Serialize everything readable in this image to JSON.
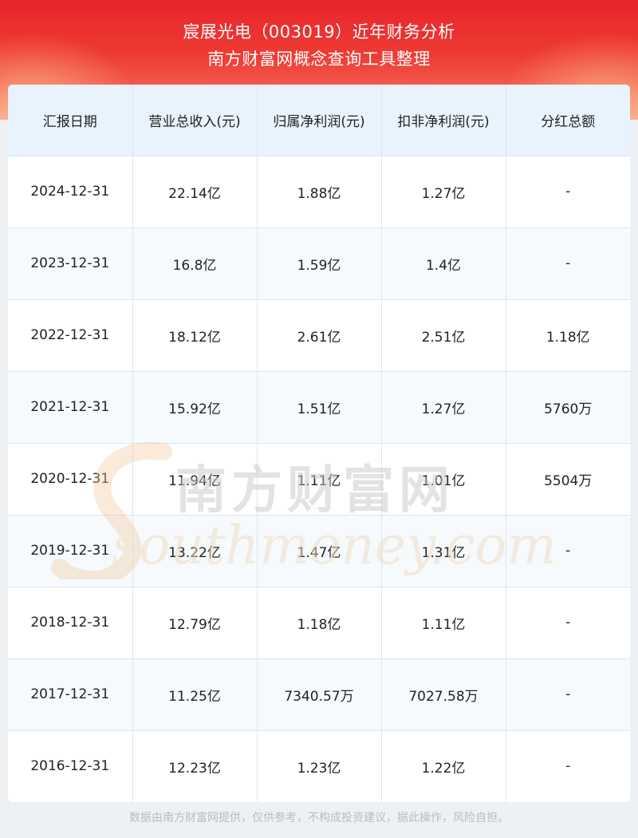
{
  "header": {
    "title_line1": "宸展光电（003019）近年财务分析",
    "title_line2": "南方财富网概念查询工具整理"
  },
  "table": {
    "columns": [
      "汇报日期",
      "营业总收入(元)",
      "归属净利润(元)",
      "扣非净利润(元)",
      "分红总额"
    ],
    "rows": [
      [
        "2024-12-31",
        "22.14亿",
        "1.88亿",
        "1.27亿",
        "-"
      ],
      [
        "2023-12-31",
        "16.8亿",
        "1.59亿",
        "1.4亿",
        "-"
      ],
      [
        "2022-12-31",
        "18.12亿",
        "2.61亿",
        "2.51亿",
        "1.18亿"
      ],
      [
        "2021-12-31",
        "15.92亿",
        "1.51亿",
        "1.27亿",
        "5760万"
      ],
      [
        "2020-12-31",
        "11.94亿",
        "1.11亿",
        "1.01亿",
        "5504万"
      ],
      [
        "2019-12-31",
        "13.22亿",
        "1.47亿",
        "1.31亿",
        "-"
      ],
      [
        "2018-12-31",
        "12.79亿",
        "1.18亿",
        "1.11亿",
        "-"
      ],
      [
        "2017-12-31",
        "11.25亿",
        "7340.57万",
        "7027.58万",
        "-"
      ],
      [
        "2016-12-31",
        "12.23亿",
        "1.23亿",
        "1.22亿",
        "-"
      ]
    ]
  },
  "watermark": {
    "cn_text": "南方财富网",
    "en_text": "southmoney.com"
  },
  "footer": {
    "disclaimer": "数据由南方财富网提供，仅供参考，不构成投资建议，据此操作，风险自担。"
  },
  "colors": {
    "header_red": "#e8242c",
    "table_header_bg": "#e9f3fd",
    "border": "#dde6ef",
    "footer_text": "#b8bcc2"
  }
}
